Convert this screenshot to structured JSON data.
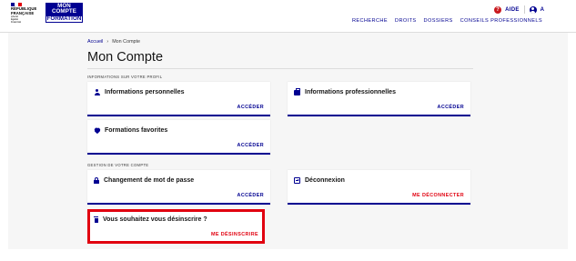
{
  "header": {
    "gov_lines": [
      "RÉPUBLIQUE",
      "FRANÇAISE"
    ],
    "gov_motto": [
      "Liberté",
      "Égalité",
      "Fraternité"
    ],
    "brand_lines": [
      "MON",
      "COMPTE",
      "FORMATION"
    ],
    "help_label": "AIDE",
    "help_icon": "question-icon",
    "account_label": "A",
    "account_icon": "user-circle-icon",
    "nav": [
      "RECHERCHE",
      "DROITS",
      "DOSSIERS",
      "CONSEILS PROFESSIONNELS"
    ],
    "colors": {
      "brand_blue": "#000091",
      "danger_red": "#e1000f",
      "flag_red": "#e1000f"
    }
  },
  "breadcrumb": {
    "home": "Accueil",
    "separator": "›",
    "current": "Mon Compte"
  },
  "page_title": "Mon Compte",
  "sections": {
    "profile": {
      "title": "INFORMATIONS SUR VOTRE PROFIL"
    },
    "account": {
      "title": "GESTION DE VOTRE COMPTE"
    }
  },
  "cards": {
    "personal_info": {
      "title": "Informations personnelles",
      "action": "ACCÉDER",
      "icon": "user-icon"
    },
    "pro_info": {
      "title": "Informations professionnelles",
      "action": "ACCÉDER",
      "icon": "briefcase-icon"
    },
    "favorites": {
      "title": "Formations favorites",
      "action": "ACCÉDER",
      "icon": "heart-icon"
    },
    "password": {
      "title": "Changement de mot de passe",
      "action": "ACCÉDER",
      "icon": "lock-icon"
    },
    "logout": {
      "title": "Déconnexion",
      "action": "ME DÉCONNECTER",
      "icon": "logout-icon"
    },
    "unsubscribe": {
      "title": "Vous souhaitez vous désinscrire ?",
      "action": "ME DÉSINSCRIRE",
      "icon": "trash-icon"
    }
  }
}
